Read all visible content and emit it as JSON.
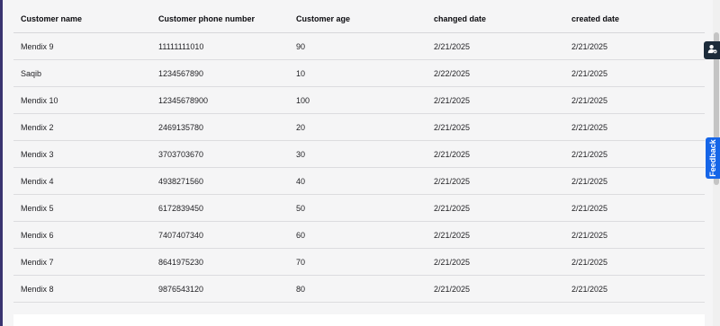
{
  "table": {
    "columns": [
      "Customer name",
      "Customer phone number",
      "Customer age",
      "changed date",
      "created date"
    ],
    "rows": [
      [
        "Mendix 9",
        "11111111010",
        "90",
        "2/21/2025",
        "2/21/2025"
      ],
      [
        "Saqib",
        "1234567890",
        "10",
        "2/22/2025",
        "2/21/2025"
      ],
      [
        "Mendix 10",
        "12345678900",
        "100",
        "2/21/2025",
        "2/21/2025"
      ],
      [
        "Mendix 2",
        "2469135780",
        "20",
        "2/21/2025",
        "2/21/2025"
      ],
      [
        "Mendix 3",
        "3703703670",
        "30",
        "2/21/2025",
        "2/21/2025"
      ],
      [
        "Mendix 4",
        "4938271560",
        "40",
        "2/21/2025",
        "2/21/2025"
      ],
      [
        "Mendix 5",
        "6172839450",
        "50",
        "2/21/2025",
        "2/21/2025"
      ],
      [
        "Mendix 6",
        "7407407340",
        "60",
        "2/21/2025",
        "2/21/2025"
      ],
      [
        "Mendix 7",
        "8641975230",
        "70",
        "2/21/2025",
        "2/21/2025"
      ],
      [
        "Mendix 8",
        "9876543120",
        "80",
        "2/21/2025",
        "2/21/2025"
      ]
    ]
  },
  "feedback": {
    "label": "Feedback"
  },
  "side_button": {
    "icon": "user-icon"
  },
  "colors": {
    "feedback_tab": "#1565e8",
    "side_button": "#1c2b3a",
    "accent_bar": "#3a3470"
  }
}
